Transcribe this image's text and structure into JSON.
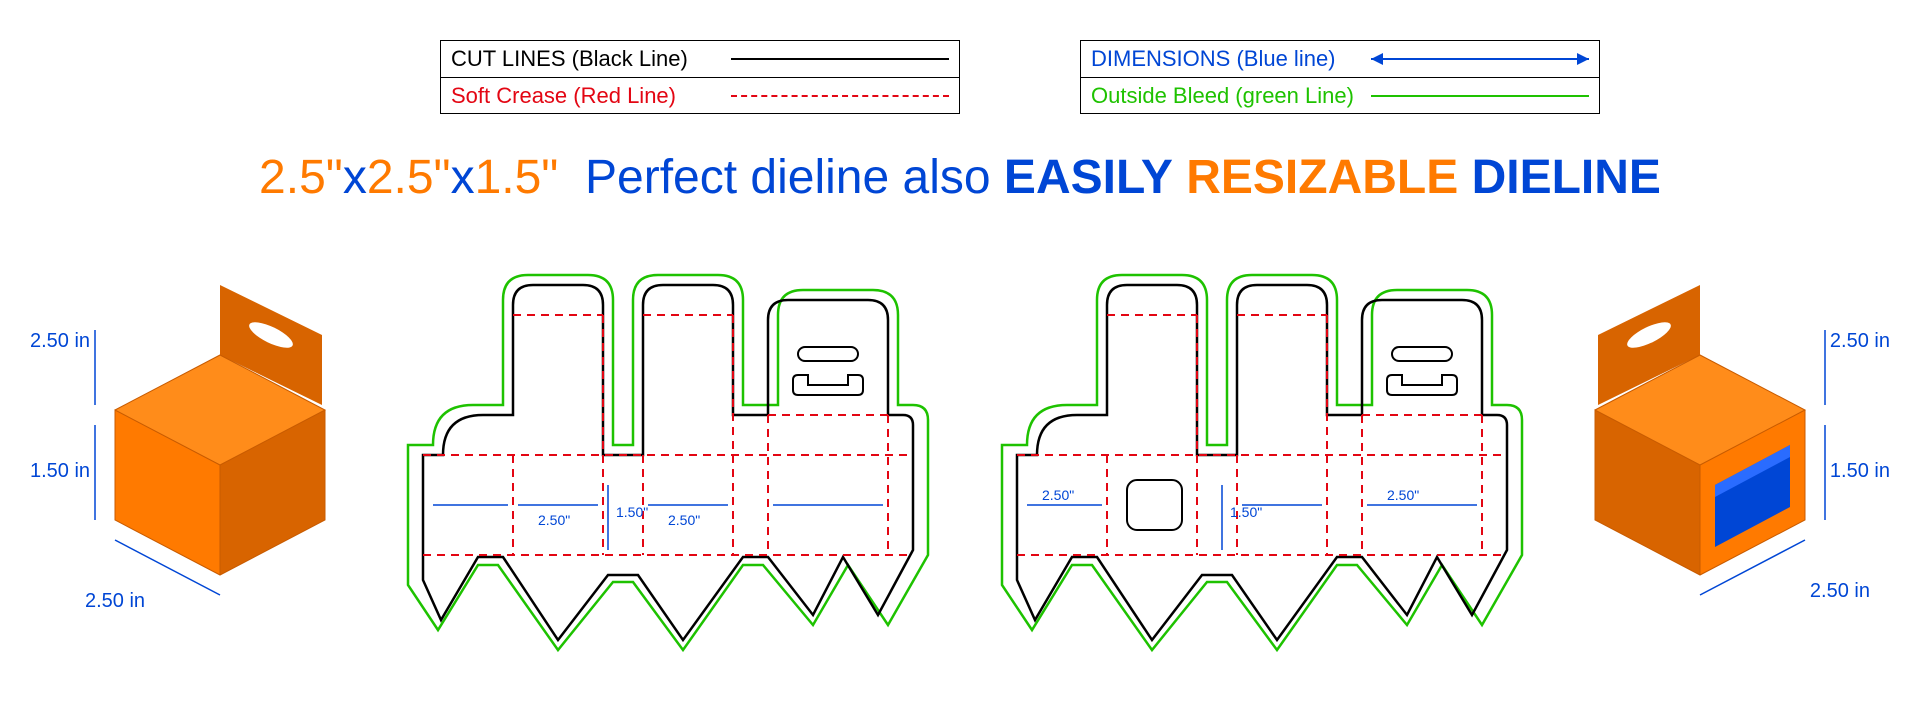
{
  "legend": {
    "left": {
      "row1": {
        "label": "CUT LINES (Black Line)",
        "color": "#000000"
      },
      "row2": {
        "label": "Soft Crease (Red Line)",
        "color": "#e30613"
      }
    },
    "right": {
      "row1": {
        "label": "DIMENSIONS (Blue line)",
        "color": "#0046d5"
      },
      "row2": {
        "label": "Outside Bleed (green Line)",
        "color": "#1ec200"
      }
    }
  },
  "headline": {
    "p1": "2.5\"",
    "x1": "x",
    "p2": "2.5\"",
    "x2": "x",
    "p3": "1.5\"",
    "mid": "Perfect dieline also",
    "easily": "EASILY",
    "resizable": "RESIZABLE",
    "dieline": "DIELINE"
  },
  "box_left": {
    "dim_w": "2.50 in",
    "dim_h": "1.50 in",
    "dim_d": "2.50 in",
    "dim_tab": "2.50 in"
  },
  "box_right": {
    "dim_w": "2.50 in",
    "dim_h": "1.50 in",
    "dim_d": "2.50 in",
    "dim_tab": "2.50 in"
  },
  "dieline_dims": {
    "panel1": "2.50\"",
    "panel2": "1.50\"",
    "panel3": "2.50\""
  },
  "colors": {
    "orange": "#ff7a00",
    "orange_dark": "#d86400",
    "blue_panel": "#0046d5",
    "cut": "#000000",
    "crease": "#e30613",
    "bleed": "#1ec200",
    "dim": "#0046d5"
  }
}
